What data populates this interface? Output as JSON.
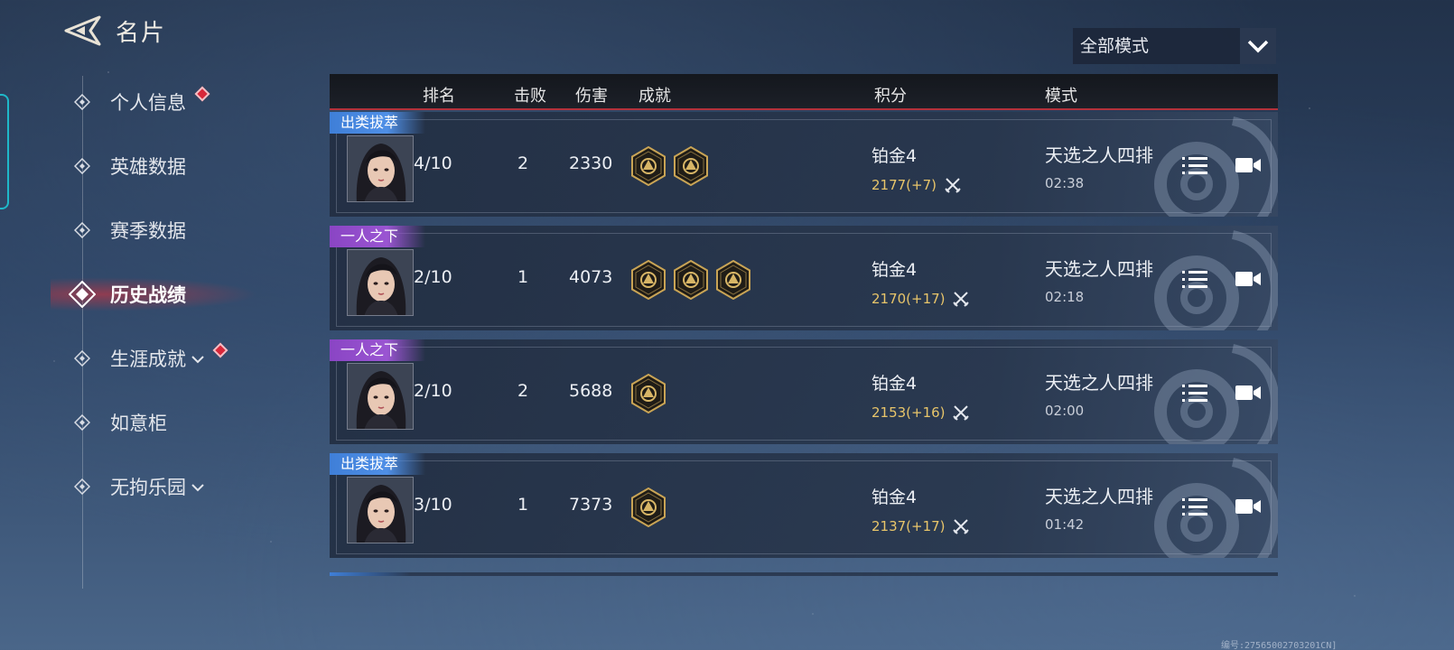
{
  "header": {
    "title": "名片"
  },
  "sidebar": {
    "items": [
      {
        "label": "个人信息",
        "dot": true
      },
      {
        "label": "英雄数据"
      },
      {
        "label": "赛季数据"
      },
      {
        "label": "历史战绩",
        "active": true
      },
      {
        "label": "生涯成就",
        "expandable": true,
        "dot": true
      },
      {
        "label": "如意柜"
      },
      {
        "label": "无拘乐园",
        "expandable": true
      }
    ]
  },
  "filter": {
    "selected": "全部模式",
    "icon": "chevron-down-icon"
  },
  "table": {
    "columns": {
      "rank": "排名",
      "kills": "击败",
      "damage": "伤害",
      "achievements": "成就",
      "score": "积分",
      "mode": "模式"
    },
    "rows": [
      {
        "badge": "出类拔萃",
        "badge_color": "#4f8fe6",
        "rank": "4/10",
        "kills": "2",
        "damage": "2330",
        "achievements": 2,
        "tier": "铂金4",
        "score": "2177(+7)",
        "mode": "天选之人四排",
        "duration": "02:38"
      },
      {
        "badge": "一人之下",
        "badge_color": "#9a55d2",
        "rank": "2/10",
        "kills": "1",
        "damage": "4073",
        "achievements": 3,
        "tier": "铂金4",
        "score": "2170(+17)",
        "mode": "天选之人四排",
        "duration": "02:18"
      },
      {
        "badge": "一人之下",
        "badge_color": "#9a55d2",
        "rank": "2/10",
        "kills": "2",
        "damage": "5688",
        "achievements": 1,
        "tier": "铂金4",
        "score": "2153(+16)",
        "mode": "天选之人四排",
        "duration": "02:00"
      },
      {
        "badge": "出类拔萃",
        "badge_color": "#4f8fe6",
        "rank": "3/10",
        "kills": "1",
        "damage": "7373",
        "achievements": 1,
        "tier": "铂金4",
        "score": "2137(+17)",
        "mode": "天选之人四排",
        "duration": "01:42"
      }
    ]
  },
  "footer": {
    "serial": "编号:27565002703201CN]"
  },
  "colors": {
    "accent_red": "#b3313b",
    "score_gold": "#e8c56a",
    "badge_blue": "#4f8fe6",
    "badge_purple": "#9a55d2"
  }
}
